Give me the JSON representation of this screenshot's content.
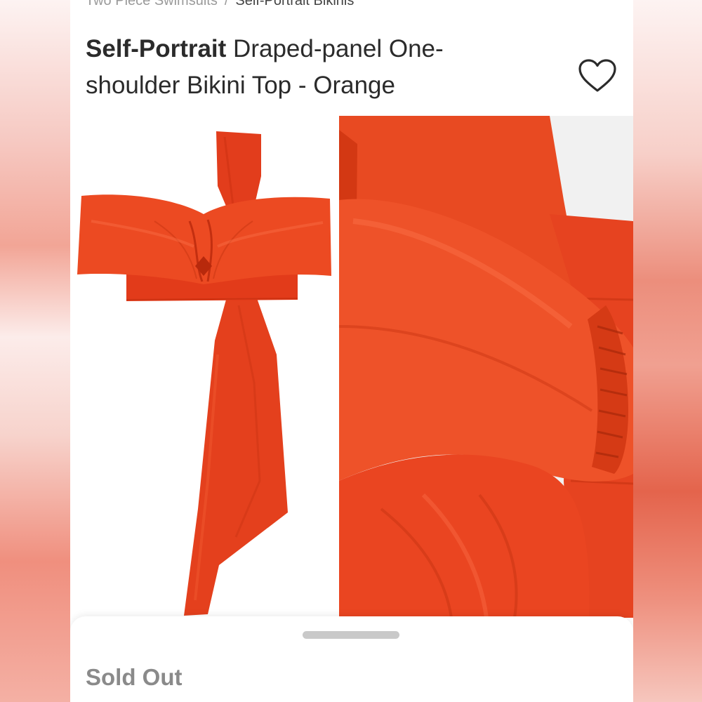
{
  "breadcrumb": {
    "items": [
      "Two Piece Swimsuits",
      "Self-Portrait Bikinis"
    ],
    "separator": "/"
  },
  "product": {
    "brand": "Self-Portrait",
    "name": "Draped-panel One-shoulder Bikini Top - Orange",
    "color_hex": "#e8401c"
  },
  "actions": {
    "like_icon": "heart-outline-icon"
  },
  "gallery": {
    "images": [
      "bikini-top-flat-front",
      "bikini-top-draped-detail"
    ]
  },
  "status": {
    "label": "Sold Out"
  }
}
